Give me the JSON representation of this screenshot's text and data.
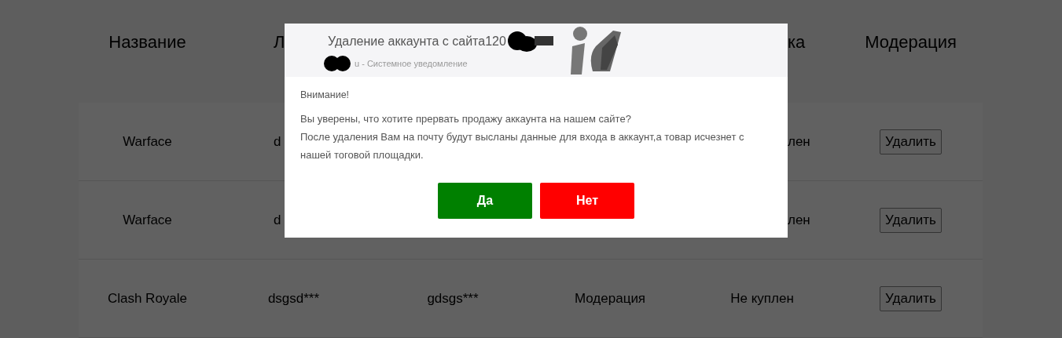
{
  "table": {
    "columns": [
      {
        "label": "Название",
        "cut_off": false
      },
      {
        "label": "Л",
        "cut_off": true
      },
      null,
      null,
      {
        "label": "ка",
        "cut_off": true
      },
      {
        "label": "Модерация",
        "cut_off": false
      }
    ],
    "rows": [
      {
        "cells": [
          {
            "text": "Warface",
            "cut_off": false
          },
          {
            "text": "d",
            "cut_off": true
          },
          null,
          null,
          {
            "text": "лен",
            "cut_off": true
          }
        ],
        "action": "Удалить"
      },
      {
        "cells": [
          {
            "text": "Warface",
            "cut_off": false
          },
          {
            "text": "d",
            "cut_off": true
          },
          null,
          null,
          {
            "text": "лен",
            "cut_off": true
          }
        ],
        "action": "Удалить"
      },
      {
        "cells": [
          {
            "text": "Clash Royale",
            "cut_off": false
          },
          {
            "text": "dsgsd***",
            "cut_off": false
          },
          {
            "text": "gdsgs***",
            "cut_off": false
          },
          {
            "text": "Модерация",
            "cut_off": false
          },
          {
            "text": "Не куплен",
            "cut_off": false
          }
        ],
        "action": "Удалить"
      }
    ]
  },
  "dialog": {
    "title": "Удаление аккаунта с сайта120",
    "subtitle": "u - Системное уведомление",
    "heading": "Внимание!",
    "message": [
      "Вы уверены, что хотите прервать продажу аккаунта на нашем сайте?",
      "После удаления Вам на почту будут высланы данные для входа в аккаунт,а товар исчезнет с нашей тоговой площадки."
    ],
    "buttons": [
      {
        "label": "Да",
        "kind": "confirm"
      },
      {
        "label": "Нет",
        "kind": "cancel"
      }
    ]
  }
}
